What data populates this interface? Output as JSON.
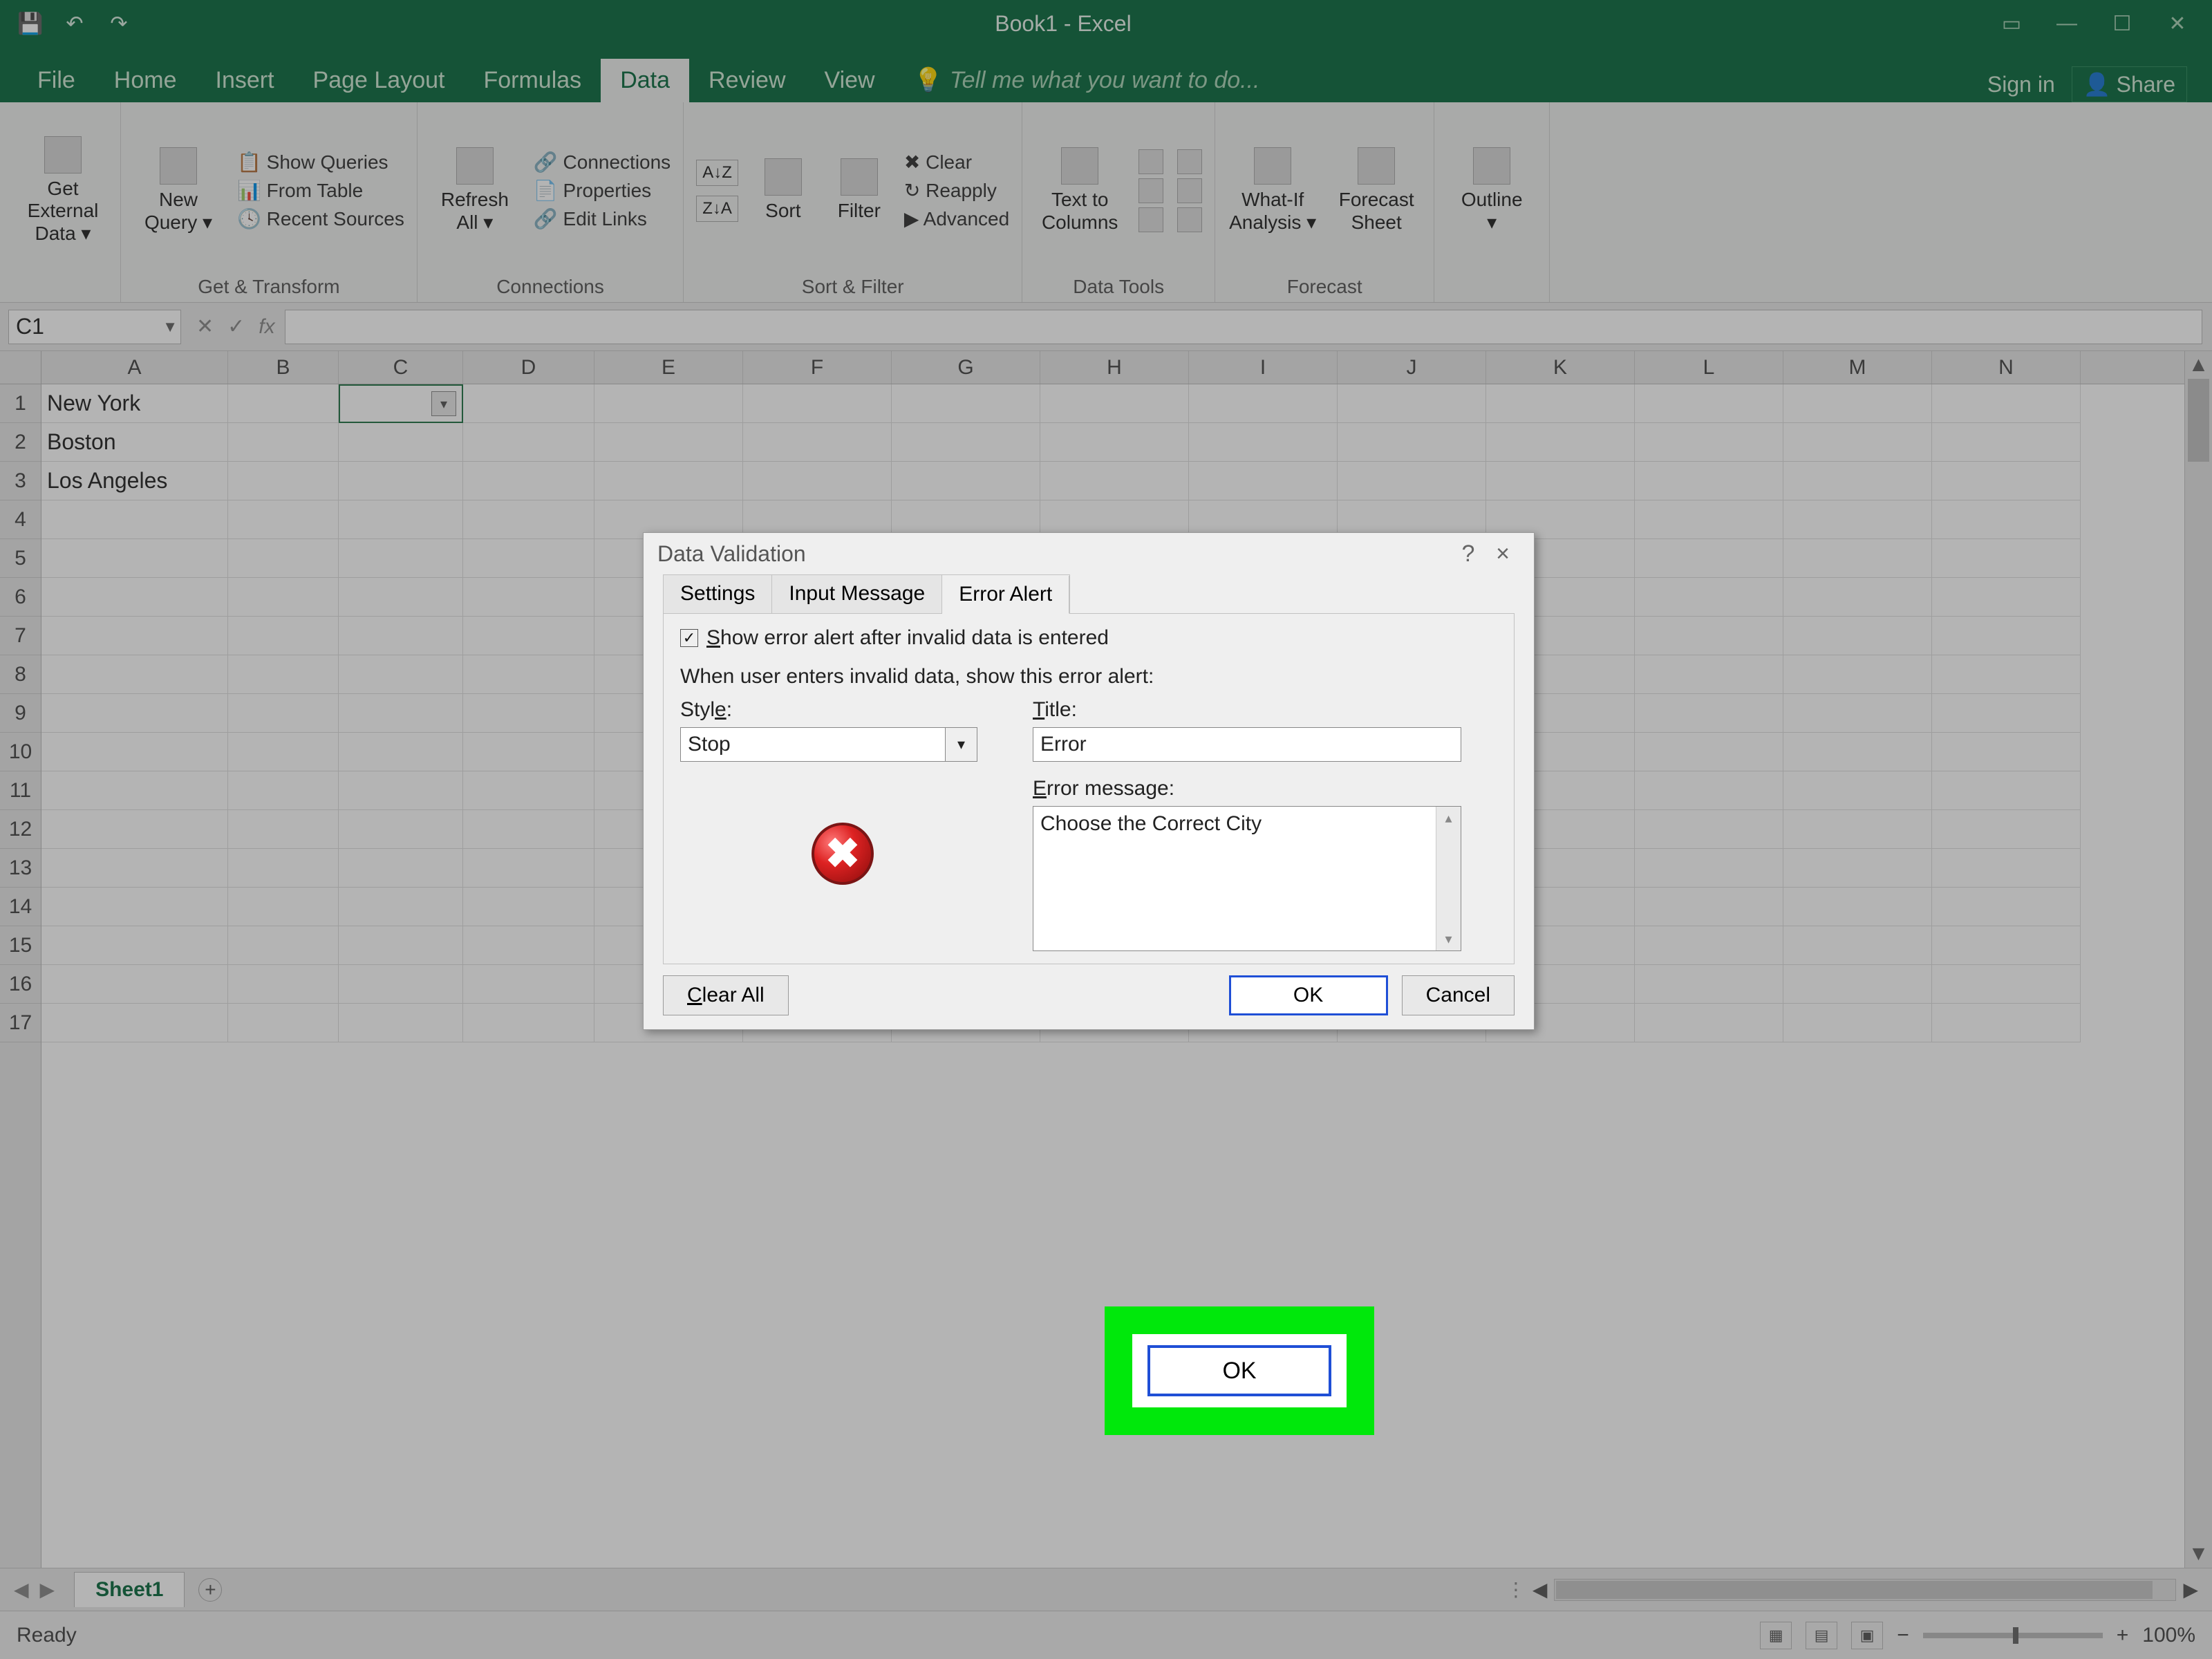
{
  "window": {
    "title": "Book1 - Excel"
  },
  "qat": {
    "save": "💾",
    "undo": "↶",
    "redo": "↷"
  },
  "tabs": {
    "file": "File",
    "home": "Home",
    "insert": "Insert",
    "pagelayout": "Page Layout",
    "formulas": "Formulas",
    "data": "Data",
    "review": "Review",
    "view": "View",
    "tellme": "Tell me what you want to do...",
    "signin": "Sign in",
    "share": "Share"
  },
  "ribbon": {
    "get_external": "Get External\nData ▾",
    "new_query": "New\nQuery ▾",
    "show_queries": "Show Queries",
    "from_table": "From Table",
    "recent_sources": "Recent Sources",
    "group_get_transform": "Get & Transform",
    "refresh_all": "Refresh\nAll ▾",
    "connections": "Connections",
    "properties": "Properties",
    "edit_links": "Edit Links",
    "group_connections": "Connections",
    "sort": "Sort",
    "filter": "Filter",
    "clear": "Clear",
    "reapply": "Reapply",
    "advanced": "Advanced",
    "group_sort_filter": "Sort & Filter",
    "text_to_columns": "Text to\nColumns",
    "group_data_tools": "Data Tools",
    "whatif": "What-If\nAnalysis ▾",
    "forecast_sheet": "Forecast\nSheet",
    "group_forecast": "Forecast",
    "outline": "Outline\n▾"
  },
  "formula_bar": {
    "namebox": "C1",
    "fx": "fx"
  },
  "columns": [
    "A",
    "B",
    "C",
    "D",
    "E",
    "F",
    "G",
    "H",
    "I",
    "J",
    "K",
    "L",
    "M",
    "N"
  ],
  "rows_visible": 17,
  "cells": {
    "A1": "New York",
    "A2": "Boston",
    "A3": "Los Angeles"
  },
  "sheet_bar": {
    "tab1": "Sheet1",
    "add": "+"
  },
  "statusbar": {
    "ready": "Ready",
    "zoom": "100%",
    "minus": "−",
    "plus": "+"
  },
  "dialog": {
    "title": "Data Validation",
    "help": "?",
    "close": "×",
    "tabs": {
      "settings": "Settings",
      "input_message": "Input Message",
      "error_alert": "Error Alert"
    },
    "show_alert": "Show error alert after invalid data is entered",
    "when_user": "When user enters invalid data, show this error alert:",
    "style_label": "Style:",
    "style_value": "Stop",
    "title_label": "Title:",
    "title_value": "Error",
    "error_msg_label": "Error message:",
    "error_msg_value": "Choose the Correct City",
    "clear_all": "Clear All",
    "ok": "OK",
    "cancel": "Cancel"
  }
}
